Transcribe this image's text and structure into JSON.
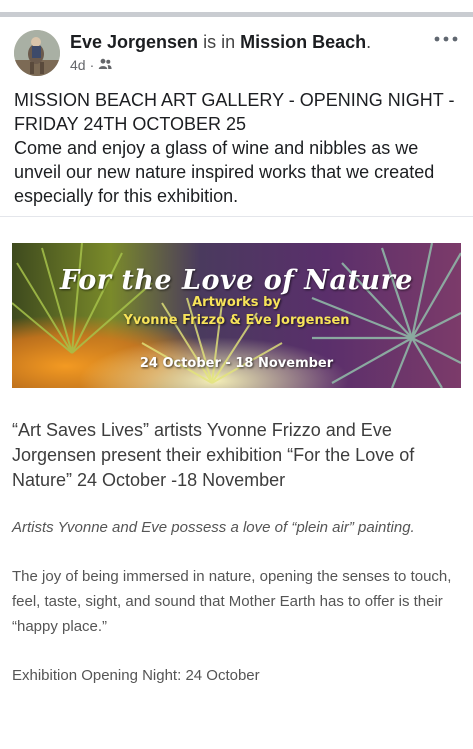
{
  "post": {
    "author": "Eve Jorgensen",
    "connector": "is in",
    "location": "Mission Beach",
    "period": ".",
    "age": "4d",
    "separator": "·",
    "audience_icon": "friends-icon",
    "more_icon": "more-options-icon",
    "text_lines": [
      "MISSION BEACH ART GALLERY - OPENING NIGHT - FRIDAY 24TH OCTOBER 25",
      "Come and enjoy a glass of wine and nibbles as we unveil our new nature inspired works that we created especially for this exhibition."
    ]
  },
  "banner": {
    "title": "For the Love of Nature",
    "subtitle": "Artworks by",
    "artists": "Yvonne Frizzo & Eve Jorgensen",
    "dates": "24 October - 18 November"
  },
  "article": {
    "lead": "“Art Saves Lives” artists Yvonne Frizzo and Eve Jorgensen present their exhibition “For the Love of Nature” 24 October -18 November",
    "quote": "Artists Yvonne and Eve possess a love of “plein air” painting.",
    "joy": "The joy of being immersed in nature, opening the senses to touch, feel, taste, sight, and sound that Mother Earth has to offer is their “happy place.”",
    "opening": "Exhibition Opening Night: 24 October"
  },
  "colors": {
    "text": "#1c1e21",
    "meta": "#65676b",
    "banner_yellow": "#f7e35a"
  }
}
